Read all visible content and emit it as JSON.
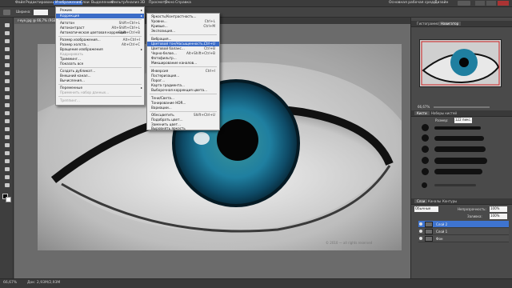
{
  "menubar": {
    "items": [
      "Файл",
      "Редактирование",
      "Изображение",
      "Слои",
      "Выделение",
      "Фильтр",
      "Анализ",
      "3D",
      "Просмотр",
      "Окно",
      "Справка"
    ],
    "workspace": "Основная рабочая среда",
    "design": "Дизайн"
  },
  "document": {
    "tab_title": "r-eye.jpg @ 66,7% (RGB/8)",
    "status_zoom": "66,67%",
    "status_doc": "Док: 2,93M/2,93M",
    "watermark": "© 2010 — all rights reserved"
  },
  "image_menu": {
    "items": [
      {
        "label": "Режим",
        "shortcut": "",
        "type": "sub"
      },
      {
        "label": "Коррекция",
        "shortcut": "",
        "type": "sub-hl"
      },
      {
        "label": "Автотон",
        "shortcut": "Shift+Ctrl+L",
        "type": "item"
      },
      {
        "label": "Автоконтраст",
        "shortcut": "Alt+Shift+Ctrl+L",
        "type": "item"
      },
      {
        "label": "Автоматическая цветовая коррекция",
        "shortcut": "Shift+Ctrl+B",
        "type": "item"
      },
      {
        "label": "Размер изображения...",
        "shortcut": "Alt+Ctrl+I",
        "type": "item"
      },
      {
        "label": "Размер холста...",
        "shortcut": "Alt+Ctrl+C",
        "type": "item"
      },
      {
        "label": "Вращение изображения",
        "shortcut": "",
        "type": "sub"
      },
      {
        "label": "Кадрировать",
        "shortcut": "",
        "type": "dis"
      },
      {
        "label": "Тримминг...",
        "shortcut": "",
        "type": "item"
      },
      {
        "label": "Показать все",
        "shortcut": "",
        "type": "item"
      },
      {
        "label": "Создать дубликат...",
        "shortcut": "",
        "type": "item"
      },
      {
        "label": "Внешний канал...",
        "shortcut": "",
        "type": "item"
      },
      {
        "label": "Вычисления...",
        "shortcut": "",
        "type": "item"
      },
      {
        "label": "Переменные",
        "shortcut": "",
        "type": "sub"
      },
      {
        "label": "Применить набор данных...",
        "shortcut": "",
        "type": "dis"
      },
      {
        "label": "Треппинг...",
        "shortcut": "",
        "type": "dis"
      }
    ]
  },
  "adjust_menu": {
    "items": [
      {
        "label": "Яркость/Контрастность...",
        "shortcut": ""
      },
      {
        "label": "Уровни...",
        "shortcut": "Ctrl+L"
      },
      {
        "label": "Кривые...",
        "shortcut": "Ctrl+M"
      },
      {
        "label": "Экспозиция...",
        "shortcut": ""
      },
      {
        "label": "Вибрация...",
        "shortcut": ""
      },
      {
        "label": "Цветовой тон/Насыщенность...",
        "shortcut": "Ctrl+U",
        "hl": true
      },
      {
        "label": "Цветовой баланс...",
        "shortcut": "Ctrl+B"
      },
      {
        "label": "Черно-белое...",
        "shortcut": "Alt+Shift+Ctrl+B"
      },
      {
        "label": "Фотофильтр...",
        "shortcut": ""
      },
      {
        "label": "Микширование каналов...",
        "shortcut": ""
      },
      {
        "label": "Инверсия",
        "shortcut": "Ctrl+I"
      },
      {
        "label": "Постеризация...",
        "shortcut": ""
      },
      {
        "label": "Порог...",
        "shortcut": ""
      },
      {
        "label": "Карта градиента...",
        "shortcut": ""
      },
      {
        "label": "Выборочная коррекция цвета...",
        "shortcut": ""
      },
      {
        "label": "Тени/Света...",
        "shortcut": ""
      },
      {
        "label": "Тонирование HDR...",
        "shortcut": ""
      },
      {
        "label": "Вариации...",
        "shortcut": ""
      },
      {
        "label": "Обесцветить",
        "shortcut": "Shift+Ctrl+U"
      },
      {
        "label": "Подобрать цвет...",
        "shortcut": ""
      },
      {
        "label": "Заменить цвет...",
        "shortcut": ""
      },
      {
        "label": "Выровнять яркость",
        "shortcut": ""
      }
    ]
  },
  "panels": {
    "top_tabs": [
      "Гистограмма",
      "Навигатор"
    ],
    "nav_zoom": "66,67%",
    "brush_tabs": [
      "Кисти",
      "Наборы кистей"
    ],
    "brush_size_label": "Размер:",
    "brush_size": "122 пикс.",
    "layers_tabs": [
      "Слои",
      "Каналы",
      "Контуры"
    ],
    "blend_mode": "Обычные",
    "opacity_label": "Непрозрачность:",
    "opacity": "100%",
    "fill_label": "Заливка:",
    "fill": "100%",
    "layers": [
      {
        "name": "Слой 2",
        "selected": true
      },
      {
        "name": "Слой 1",
        "selected": false
      },
      {
        "name": "Фон",
        "selected": false
      }
    ]
  },
  "options": {
    "width_label": "Ширина:",
    "height_label": "Высота:",
    "resolution_label": "Разрешение:"
  },
  "colors": {
    "menu_highlight": "#3b6cc7",
    "iris": "#1f7fa0"
  }
}
